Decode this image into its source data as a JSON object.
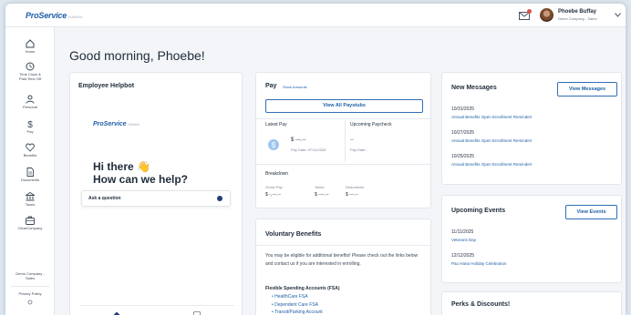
{
  "header": {
    "logo_text": "ProService",
    "logo_sub": "HAWAII",
    "user_name": "Phoebe Buffay",
    "user_company": "Demo Company - Sales"
  },
  "sidebar": {
    "items": [
      {
        "label": "Home",
        "icon": "home-icon"
      },
      {
        "label": "Time Clock &",
        "label2": "Paid Time Off",
        "icon": "clock-icon"
      },
      {
        "label": "Personal",
        "icon": "person-icon"
      },
      {
        "label": "Pay",
        "icon": "dollar-icon"
      },
      {
        "label": "Benefits",
        "icon": "heart-icon"
      },
      {
        "label": "Documents",
        "icon": "document-icon"
      },
      {
        "label": "Taxes",
        "icon": "bank-icon"
      },
      {
        "label": "ClearCompany",
        "icon": "briefcase-icon"
      }
    ],
    "company_line1": "Demo Company -",
    "company_line2": "Sales",
    "privacy": "Privacy Policy"
  },
  "greeting": "Good morning, Phoebe!",
  "helpbot": {
    "title": "Employee Helpbot",
    "logo_text": "ProService",
    "logo_sub": "HAWAII",
    "hello": "Hi there",
    "question": "How can we help?",
    "ask_label": "Ask a question"
  },
  "pay": {
    "title": "Pay",
    "show_amounts": "Show Amounts",
    "view_all": "View All Paystubs",
    "latest_label": "Latest Pay",
    "upcoming_label": "Upcoming Paycheck",
    "latest_amount": "$ ---.--",
    "latest_date": "Pay Date: 07/11/2025",
    "upcoming_amount": "--",
    "upcoming_date": "Pay Date: -",
    "breakdown_label": "Breakdown",
    "gross_label": "Gross Pay",
    "taxes_label": "Taxes",
    "deductions_label": "Deductions",
    "gross_value": "$ -,---.--",
    "taxes_value": "$ ----.--",
    "deductions_value": "$ ---.--"
  },
  "voluntary": {
    "title": "Voluntary Benefits",
    "body": "You may be eligible for additional benefits! Please check out the links below and contact us if you are interested in enrolling.",
    "fsa_heading": "Flexible Spending Accounts (FSA)",
    "fsa_items": [
      "HealthCare FSA",
      "Dependent Care FSA",
      "Transit/Parking Account"
    ]
  },
  "messages": {
    "title": "New Messages",
    "button": "View Messages",
    "items": [
      {
        "date": "10/31/2025",
        "text": "Annual Benefits Open Enrollment Reminder!"
      },
      {
        "date": "10/27/2025",
        "text": "Annual Benefits Open Enrollment Reminder!"
      },
      {
        "date": "10/25/2025",
        "text": "Annual Benefits Open Enrollment Reminder!"
      }
    ]
  },
  "events": {
    "title": "Upcoming Events",
    "button": "View Events",
    "items": [
      {
        "date": "11/11/2025",
        "text": "Veterans Day"
      },
      {
        "date": "12/12/2025",
        "text": "Pau Hana Holiday Celebration"
      }
    ]
  },
  "perks": {
    "title": "Perks & Discounts!"
  },
  "colors": {
    "accent": "#1f5fa8",
    "background": "#f3f5f8",
    "text": "#1f2b3a"
  }
}
